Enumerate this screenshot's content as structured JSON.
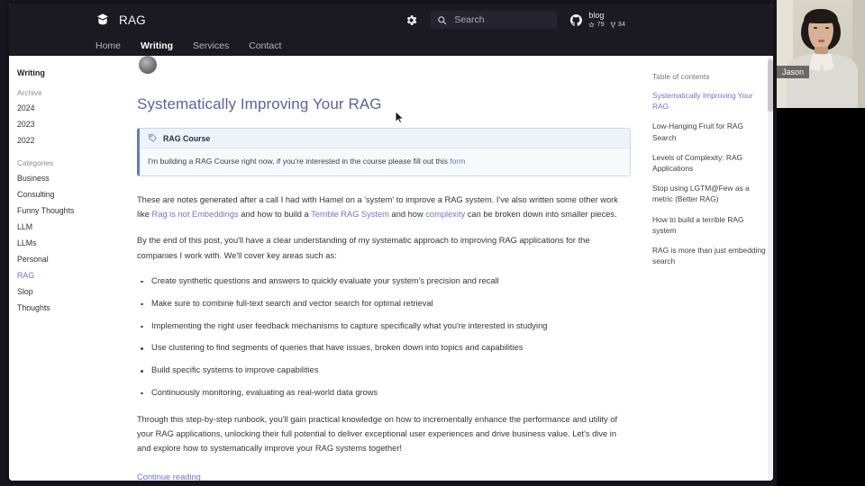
{
  "site": {
    "brand": "RAG",
    "brand_icon": "book-logo-icon",
    "nav": [
      {
        "label": "Home",
        "active": false
      },
      {
        "label": "Writing",
        "active": true
      },
      {
        "label": "Services",
        "active": false
      },
      {
        "label": "Contact",
        "active": false
      }
    ],
    "gear_icon": "gear-icon",
    "search": {
      "placeholder": "Search",
      "icon": "search-icon"
    },
    "github": {
      "icon": "github-icon",
      "repo": "blog",
      "stars": "79",
      "forks": "34"
    }
  },
  "sidebar": {
    "title": "Writing",
    "archive_label": "Archive",
    "archive": [
      "2024",
      "2023",
      "2022"
    ],
    "categories_label": "Categories",
    "categories": [
      {
        "label": "Business",
        "active": false
      },
      {
        "label": "Consulting",
        "active": false
      },
      {
        "label": "Funny Thoughts",
        "active": false
      },
      {
        "label": "LLM",
        "active": false
      },
      {
        "label": "LLMs",
        "active": false
      },
      {
        "label": "Personal",
        "active": false
      },
      {
        "label": "RAG",
        "active": true
      },
      {
        "label": "Slop",
        "active": false
      },
      {
        "label": "Thoughts",
        "active": false
      }
    ]
  },
  "article": {
    "title": "Systematically Improving Your RAG",
    "callout": {
      "icon": "tag-icon",
      "title": "RAG Course",
      "body_before": "I'm building a RAG Course right now, if you're interested in the course please fill out this ",
      "link": "form"
    },
    "paragraph1": {
      "t1": "These are notes generated after a call I had with Hamel on a 'system' to improve a RAG system. I've also written some other work like ",
      "link1": "Rag is not Embeddings",
      "t2": " and how to build a ",
      "link2": "Terrible RAG System",
      "t3": " and how ",
      "link3": "complexity",
      "t4": " can be broken down into smaller pieces."
    },
    "paragraph2": "By the end of this post, you'll have a clear understanding of my systematic approach to improving RAG applications for the companies I work with. We'll cover key areas such as:",
    "bullets": [
      "Create synthetic questions and answers to quickly evaluate your system's precision and recall",
      "Make sure to combine full-text search and vector search for optimal retrieval",
      "Implementing the right user feedback mechanisms to capture specifically what you're interested in studying",
      "Use clustering to find segments of queries that have issues, broken down into topics and capabilities",
      "Build specific systems to improve capabilities",
      "Continuously monitoring, evaluating as real-world data grows"
    ],
    "paragraph3": "Through this step-by-step runbook, you'll gain practical knowledge on how to incrementally enhance the performance and utility of your RAG applications, unlocking their full potential to deliver exceptional user experiences and drive business value. Let's dive in and explore how to systematically improve your RAG systems together!",
    "continue_link": "Continue reading"
  },
  "toc": {
    "label": "Table of contents",
    "items": [
      {
        "label": "Systematically Improving Your RAG",
        "active": true
      },
      {
        "label": "Low-Hanging Fruit for RAG Search",
        "active": false
      },
      {
        "label": "Levels of Complexity: RAG Applications",
        "active": false
      },
      {
        "label": "Stop using LGTM@Few as a metric (Better RAG)",
        "active": false
      },
      {
        "label": "How to build a terrible RAG system",
        "active": false
      },
      {
        "label": "RAG is more than just embedding search",
        "active": false
      }
    ]
  },
  "video": {
    "participant_name": "Jason"
  },
  "colors": {
    "header_bg": "#1b1a23",
    "accent_link": "#6f74c4",
    "callout_border": "#5b7fc4",
    "page_bg": "#ffffff"
  }
}
